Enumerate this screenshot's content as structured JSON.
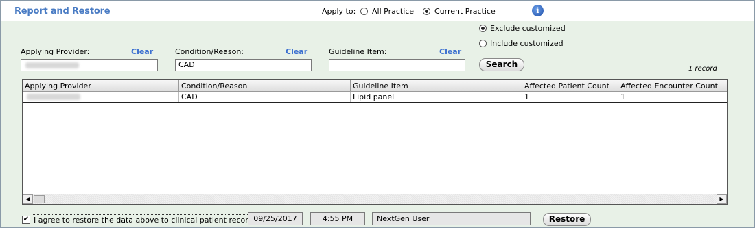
{
  "header": {
    "title": "Report and Restore",
    "apply_to_label": "Apply to:",
    "apply_options": [
      {
        "label": "All Practice",
        "checked": false
      },
      {
        "label": "Current Practice",
        "checked": true
      }
    ],
    "info_icon": "info-icon",
    "info_glyph": "i"
  },
  "filters": {
    "provider_label": "Applying Provider:",
    "provider_clear": "Clear",
    "condition_label": "Condition/Reason:",
    "condition_clear": "Clear",
    "condition_value": "CAD",
    "guideline_label": "Guideline Item:",
    "guideline_clear": "Clear",
    "guideline_value": "",
    "customized_options": [
      {
        "label": "Exclude customized",
        "checked": true
      },
      {
        "label": "Include customized",
        "checked": false
      }
    ],
    "search_label": "Search",
    "record_count": "1 record"
  },
  "grid": {
    "columns": [
      "Applying Provider",
      "Condition/Reason",
      "Guideline Item",
      "Affected Patient Count",
      "Affected Encounter Count"
    ],
    "rows": [
      {
        "provider": "",
        "condition": "CAD",
        "guideline": "Lipid panel",
        "patient_count": "1",
        "encounter_count": "1"
      }
    ],
    "scroll_left": "◀",
    "scroll_right": "▶"
  },
  "footer": {
    "agree_checked": true,
    "agree_mark": "✔",
    "agree_label": "I agree to restore the data above to clinical patient records",
    "date": "09/25/2017",
    "time": "4:55 PM",
    "user": "NextGen User",
    "restore_label": "Restore"
  },
  "colors": {
    "title": "#4a7cc4",
    "panel_bg": "#e8f1e7",
    "link": "#3b6fd0"
  }
}
